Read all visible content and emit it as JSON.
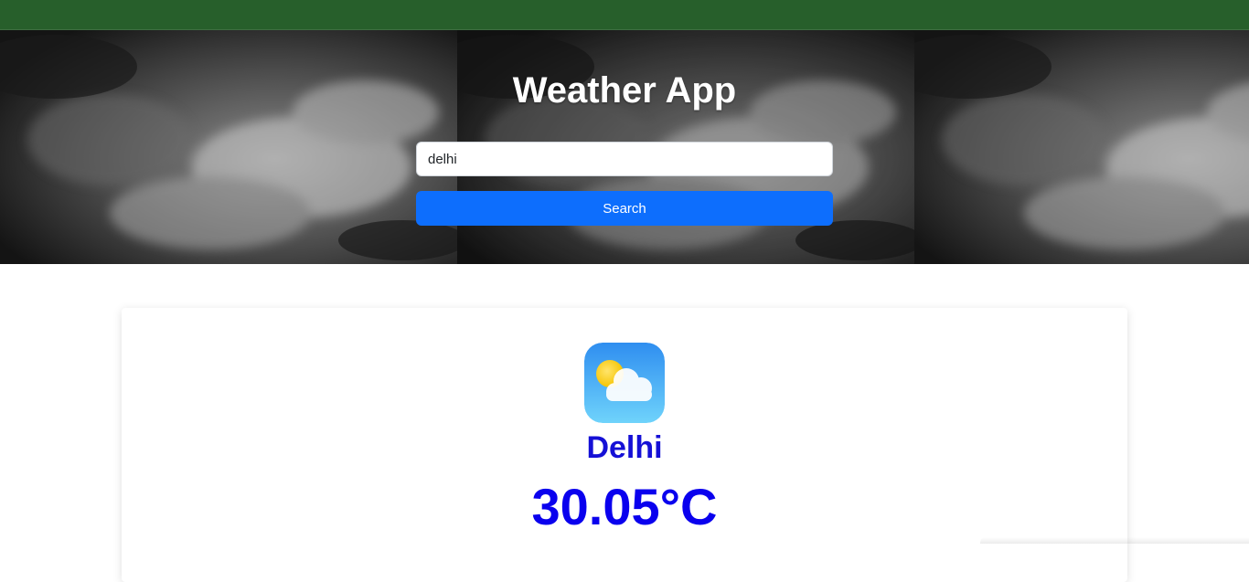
{
  "header": {
    "title": "Weather App"
  },
  "search": {
    "value": "delhi",
    "button_label": "Search"
  },
  "result": {
    "icon": "partly-cloudy-icon",
    "city": "Delhi",
    "temperature": "30.05°C"
  },
  "colors": {
    "topbar": "#275f2b",
    "button": "#0d6efd",
    "city_text": "#1510d6",
    "temperature_text": "#0a00ee"
  }
}
